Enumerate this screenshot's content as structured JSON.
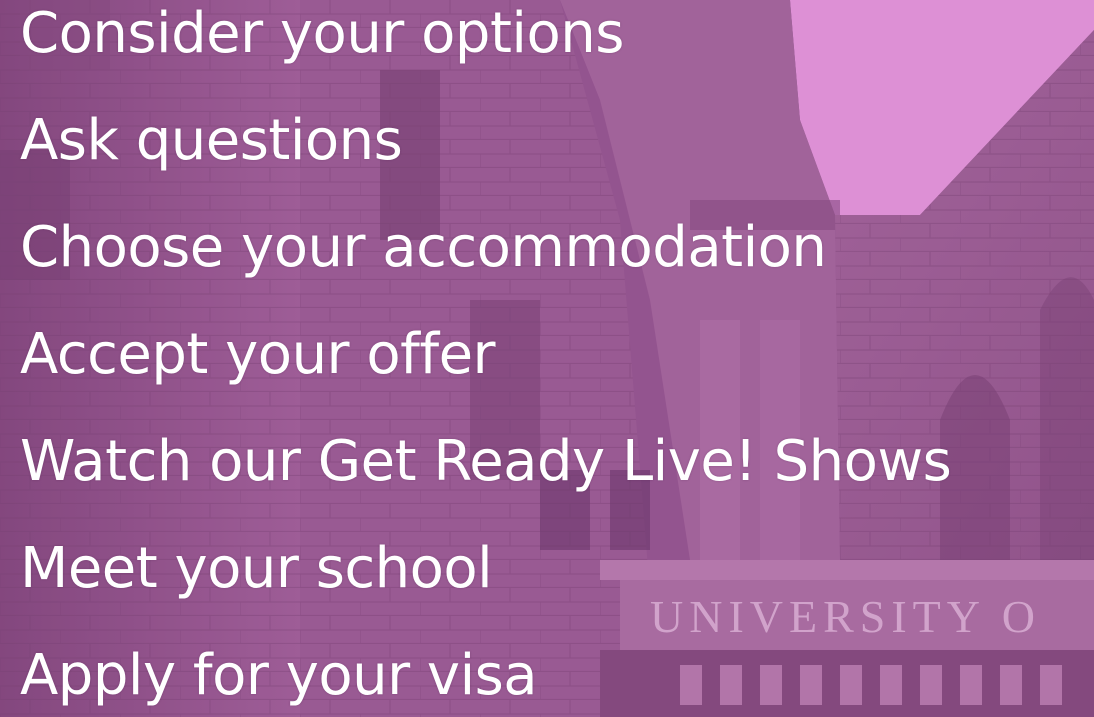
{
  "items": [
    "Consider your options",
    "Ask questions",
    "Choose your accommodation",
    "Accept your offer",
    "Watch our Get Ready Live! Shows",
    "Meet your school",
    "Apply for your visa"
  ],
  "building_inscription": "UNIVERSITY O",
  "colors": {
    "overlay_tint": "#b060a8",
    "sky": "#e89ae0",
    "stone_light": "#a76aa1",
    "stone_dark": "#6e3b6b",
    "text": "#ffffff"
  }
}
